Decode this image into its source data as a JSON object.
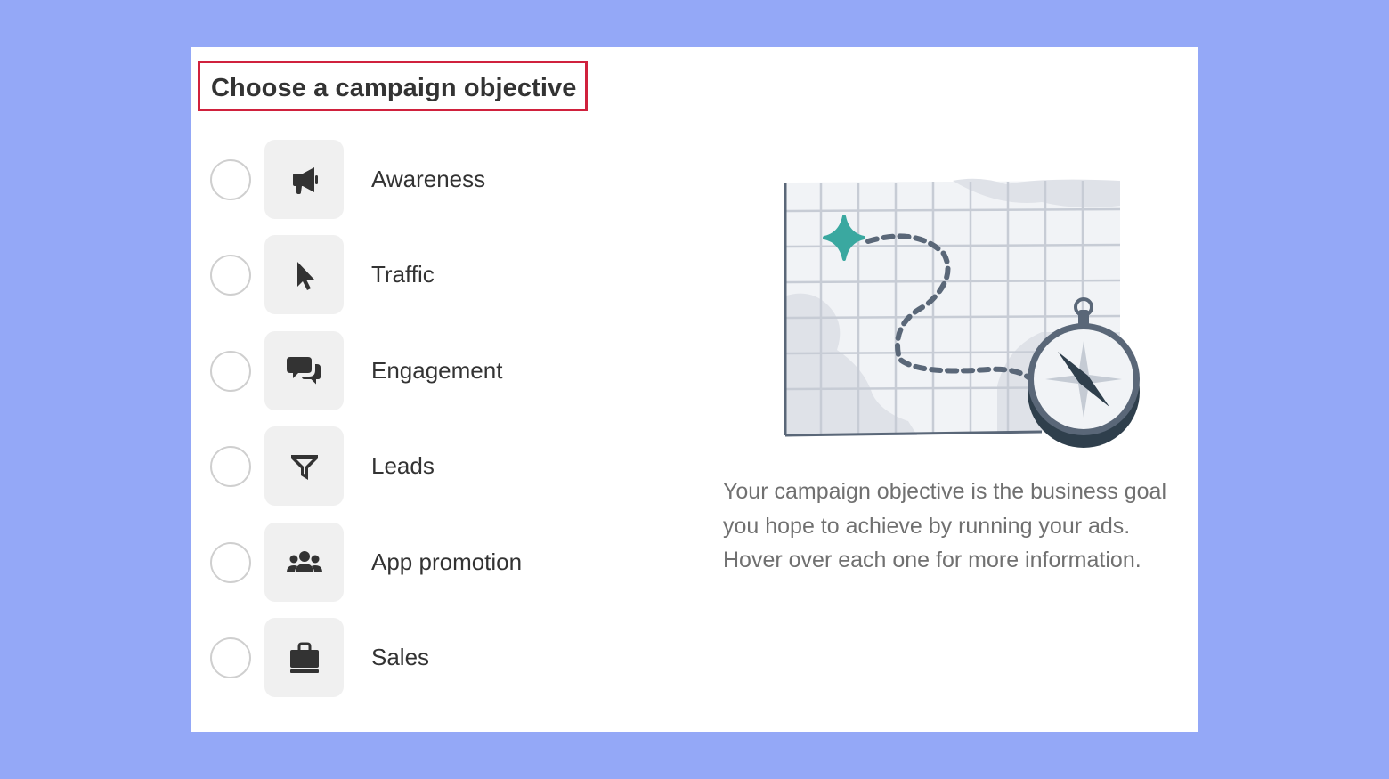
{
  "page": {
    "title": "Choose a campaign objective"
  },
  "objectives": [
    {
      "label": "Awareness",
      "icon": "megaphone-icon"
    },
    {
      "label": "Traffic",
      "icon": "cursor-icon"
    },
    {
      "label": "Engagement",
      "icon": "chat-bubbles-icon"
    },
    {
      "label": "Leads",
      "icon": "funnel-icon"
    },
    {
      "label": "App promotion",
      "icon": "people-group-icon"
    },
    {
      "label": "Sales",
      "icon": "shopping-bag-icon"
    }
  ],
  "info": {
    "description": "Your campaign objective is the business goal you hope to achieve by running your ads. Hover over each one for more information.",
    "illustration": "map-compass-illustration"
  },
  "colors": {
    "background": "#94a8f7",
    "panel": "#ffffff",
    "highlight_border": "#d0213d",
    "icon": "#333333",
    "icon_tile": "#f0f0f0",
    "radio_border": "#cfcfcf",
    "star": "#3aa8a0"
  }
}
